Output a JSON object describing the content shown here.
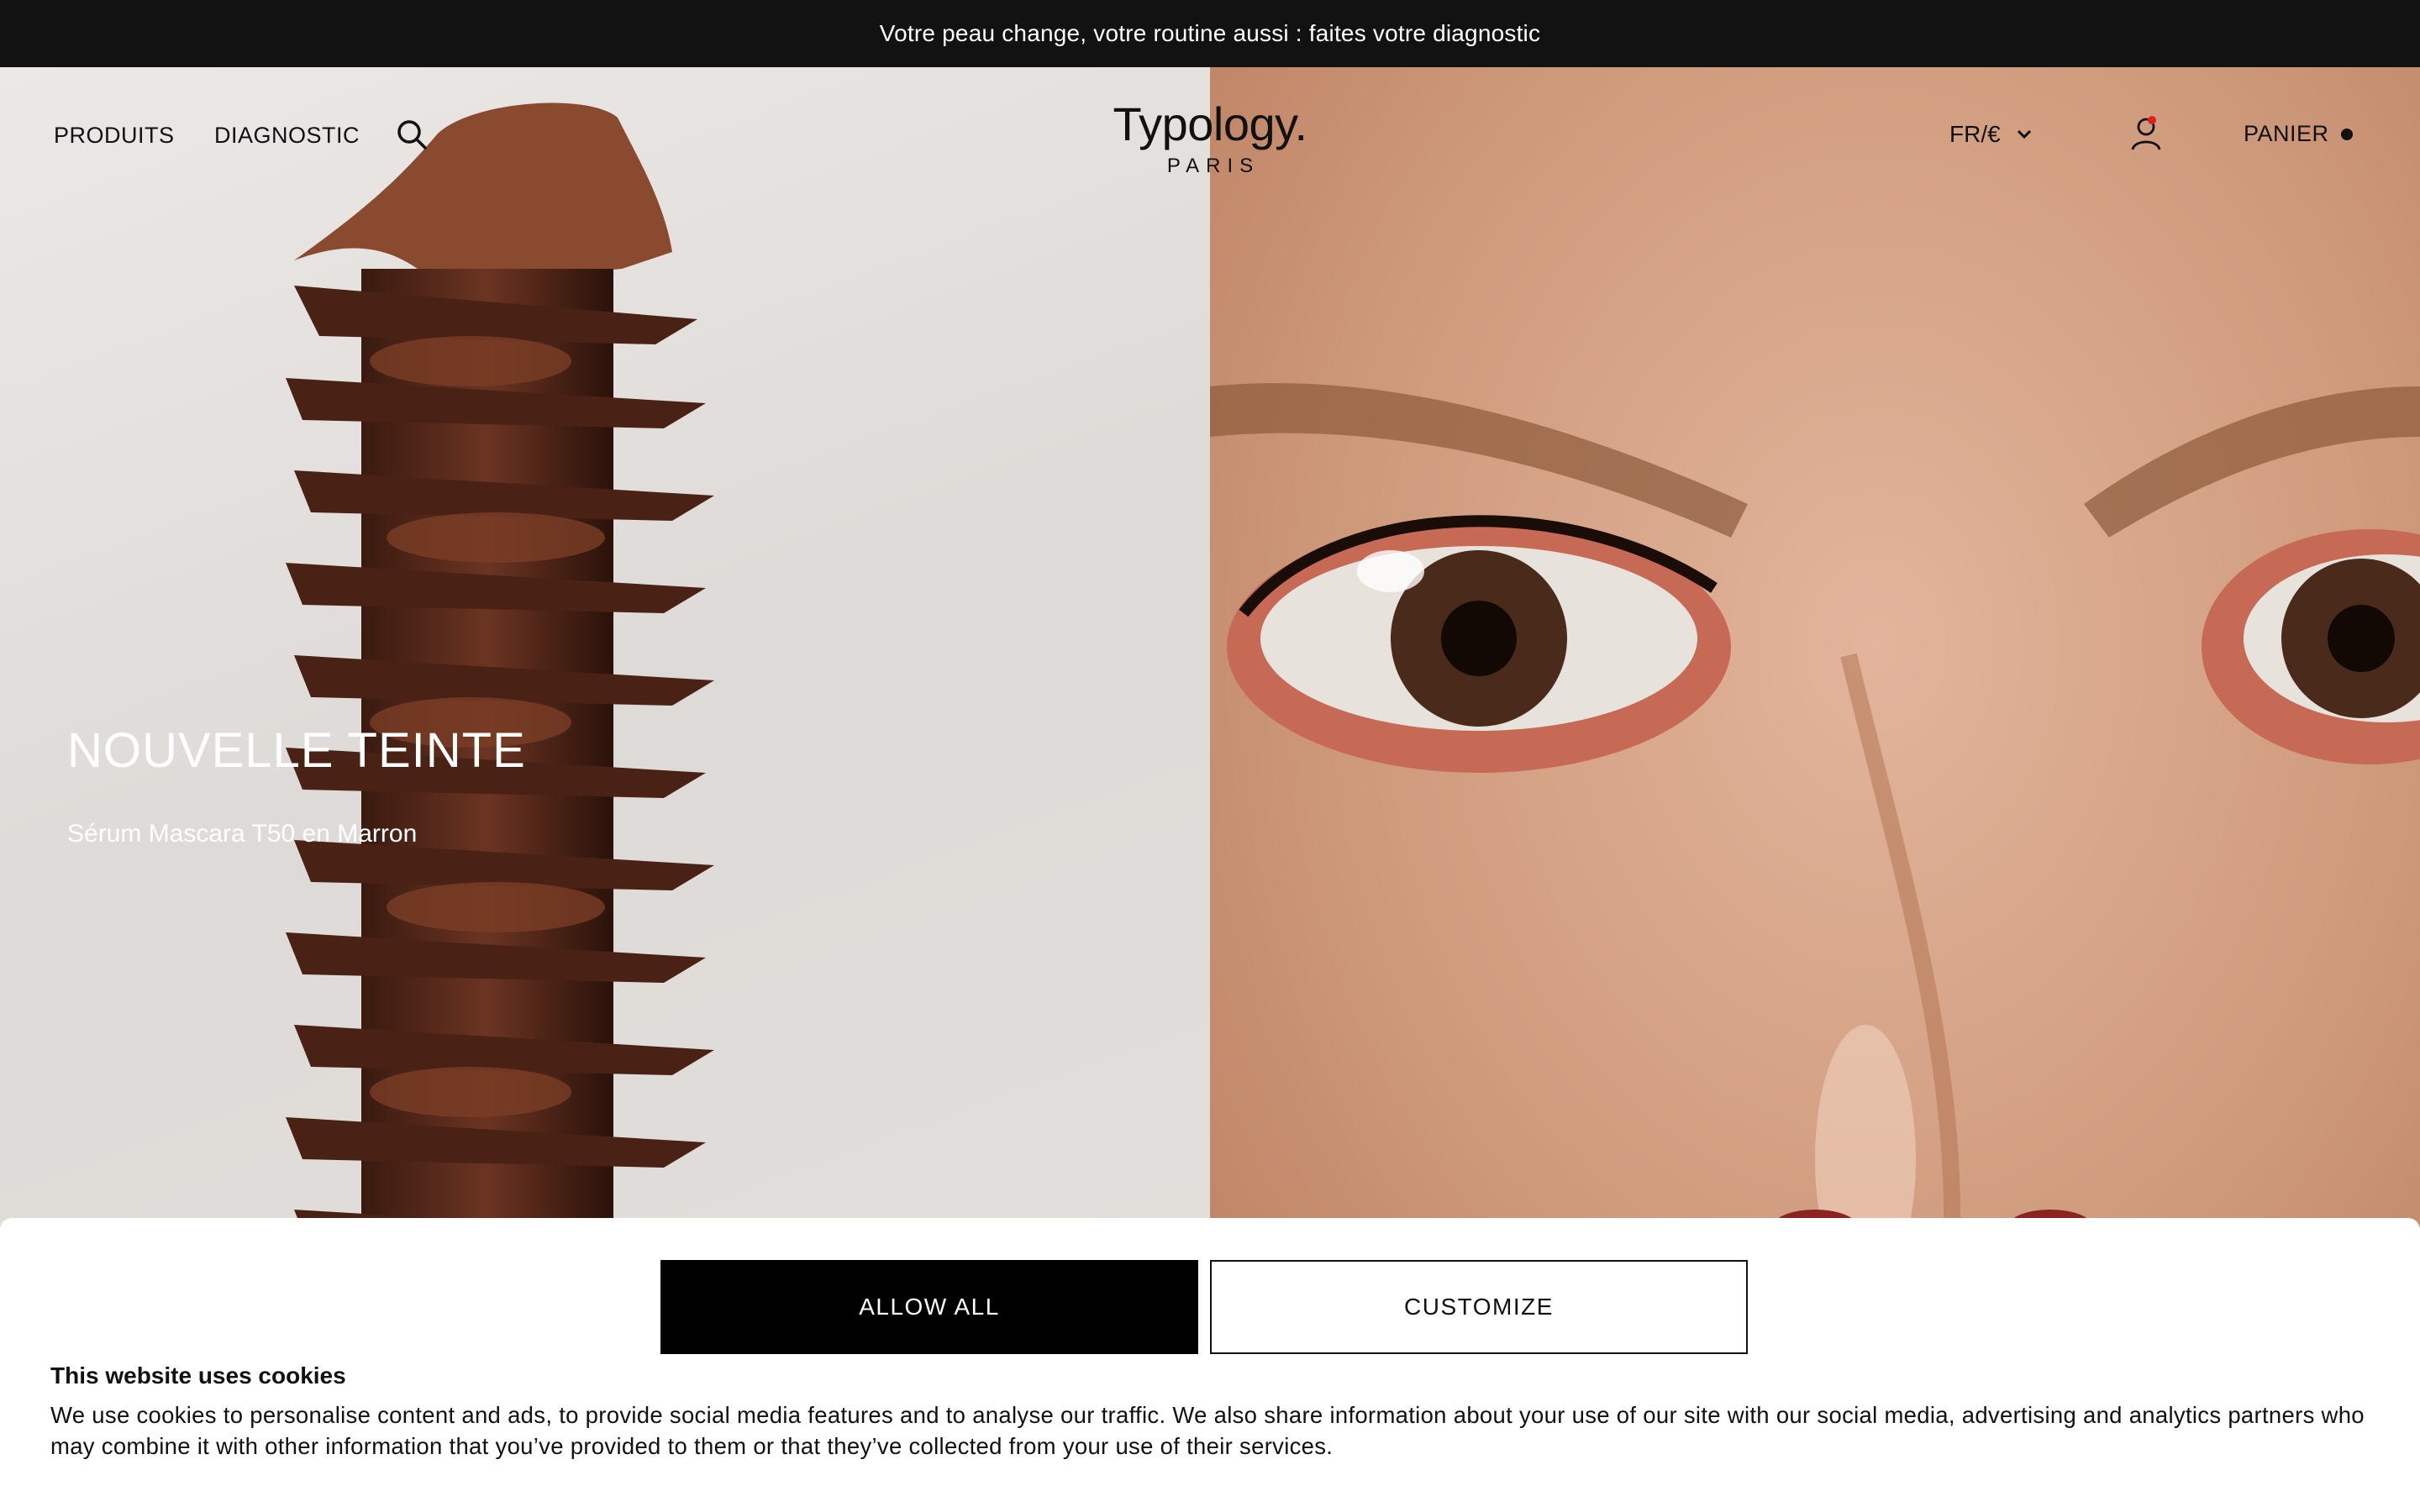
{
  "announcement": {
    "text": "Votre peau change, votre routine aussi : faites votre diagnostic"
  },
  "header": {
    "nav": [
      {
        "label": "PRODUITS"
      },
      {
        "label": "DIAGNOSTIC"
      }
    ],
    "search_icon": "search-icon",
    "logo": {
      "name": "Typology.",
      "tagline": "PARIS"
    },
    "language": {
      "label": "FR/€",
      "icon": "chevron-down-icon"
    },
    "account_icon": "user-icon",
    "cart": {
      "label": "PANIER"
    }
  },
  "hero": {
    "title": "NOUVELLE TEINTE",
    "subtitle": "Sérum Mascara T50 en Marron"
  },
  "cookie_banner": {
    "allow_label": "ALLOW ALL",
    "customize_label": "CUSTOMIZE",
    "title": "This website uses cookies",
    "body": "We use cookies to personalise content and ads, to provide social media features and to analyse our traffic. We also share information about your use of our site with our social media, advertising and analytics partners who may combine it with other information that you’ve provided to them or that they’ve collected from your use of their services."
  },
  "colors": {
    "announcement_bg": "#121212",
    "primary_button": "#000000",
    "text": "#111111",
    "account_dot": "#e02020"
  }
}
